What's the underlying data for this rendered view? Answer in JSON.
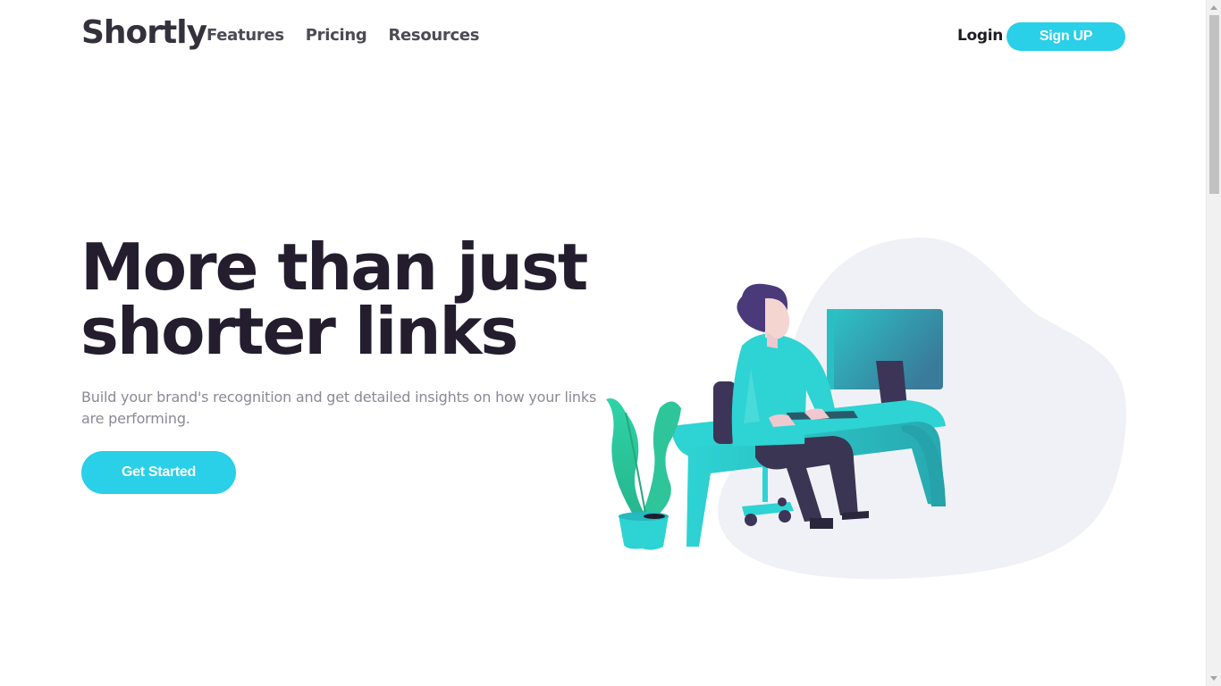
{
  "header": {
    "logo": "Shortly",
    "nav": [
      {
        "label": "Features"
      },
      {
        "label": "Pricing"
      },
      {
        "label": "Resources"
      }
    ],
    "login_label": "Login",
    "signup_label": "Sign UP"
  },
  "hero": {
    "headline": "More than just shorter links",
    "subtext": "Build your brand's recognition and get detailed insights on how your links are performing.",
    "cta_label": "Get Started",
    "illustration_icon": "person-working-at-desk-illustration"
  },
  "colors": {
    "accent": "#2acfe8",
    "headline": "#231d2e",
    "text_muted": "#8b8995",
    "blob": "#f0f1f6"
  }
}
